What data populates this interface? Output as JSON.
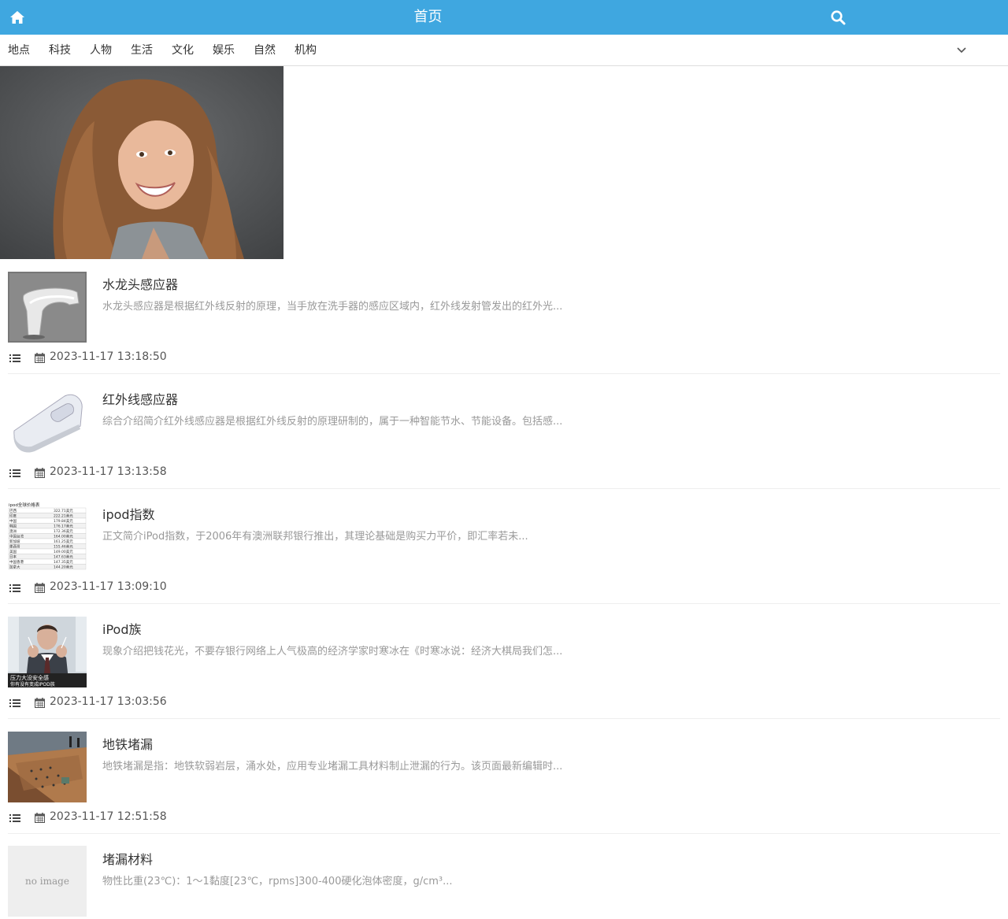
{
  "header": {
    "title": "首页",
    "home_icon": "home-icon",
    "search_icon": "search-icon",
    "bg_color": "#3fa7e0"
  },
  "categories": [
    "地点",
    "科技",
    "人物",
    "生活",
    "文化",
    "娱乐",
    "自然",
    "机构"
  ],
  "expand_icon": "chevron-down-icon",
  "banner": {
    "image": "smiling woman with long wavy auburn hair, grey t-shirt"
  },
  "articles": [
    {
      "title": "水龙头感应器",
      "summary": "水龙头感应器是根据红外线反射的原理，当手放在洗手器的感应区域内，红外线发射管发出的红外光...",
      "date": "2023-11-17 13:18:50"
    },
    {
      "title": "红外线感应器",
      "summary": "综合介绍简介红外线感应器是根据红外线反射的原理研制的，属于一种智能节水、节能设备。包括感...",
      "date": "2023-11-17 13:13:58"
    },
    {
      "title": "ipod指数",
      "summary": "正文简介iPod指数，于2006年有澳洲联邦银行推出，其理论基础是购买力平价，即汇率若未...",
      "date": "2023-11-17 13:09:10"
    },
    {
      "title": "iPod族",
      "summary": "现象介绍把钱花光，不要存银行网络上人气极高的经济学家时寒冰在《时寒冰说：经济大棋局我们怎...",
      "date": "2023-11-17 13:03:56"
    },
    {
      "title": "地铁堵漏",
      "summary": "地铁堵漏是指：地铁软弱岩层，涌水处，应用专业堵漏工具材料制止泄漏的行为。该页面最新编辑时...",
      "date": "2023-11-17 12:51:58"
    },
    {
      "title": "堵漏材料",
      "summary": "物性比重(23℃)：1～1黏度[23℃，rpms]300-400硬化泡体密度，g/cm³...",
      "date": ""
    }
  ],
  "no_image_label": "no image",
  "thumb_texts": {
    "ipod_table_title": "ipod全球价格表",
    "ipod_table_rows": [
      [
        "巴西",
        "322.71美元"
      ],
      [
        "印度",
        "222.21美元"
      ],
      [
        "中国",
        "179.84美元"
      ],
      [
        "韩国",
        "176.17美元"
      ],
      [
        "澳洲",
        "172.36美元"
      ],
      [
        "中国台湾",
        "164.00美元"
      ],
      [
        "新加坡",
        "161.25美元"
      ],
      [
        "墨西哥",
        "155.46美元"
      ],
      [
        "美国",
        "149.00美元"
      ],
      [
        "日本",
        "147.63美元"
      ],
      [
        "中国香港",
        "147.35美元"
      ],
      [
        "加拿大",
        "144.20美元"
      ]
    ],
    "ipod_man_caption_1": "压力大没安全感",
    "ipod_man_caption_2": "你有没有变成IPOD族"
  }
}
